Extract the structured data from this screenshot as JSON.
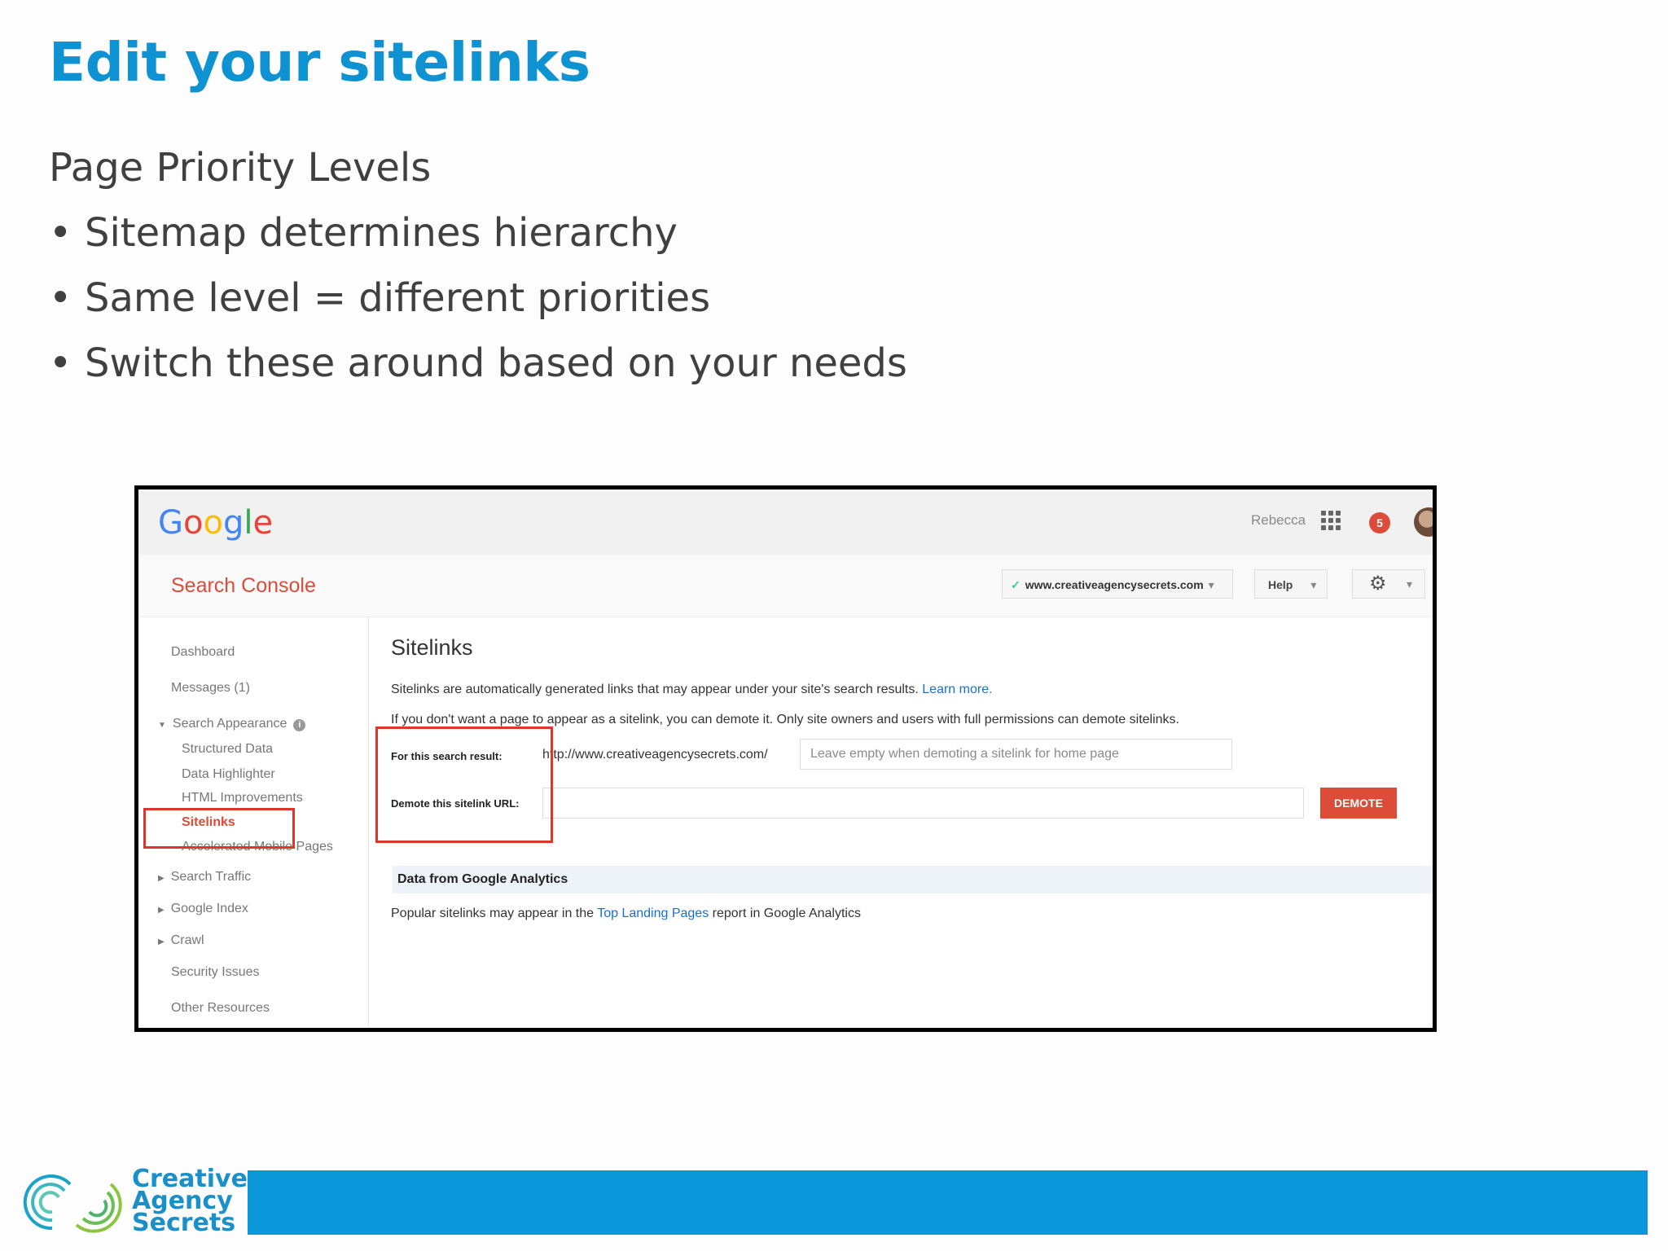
{
  "slide": {
    "title": "Edit your sitelinks",
    "subtitle": "Page Priority Levels",
    "bullets": [
      "Sitemap determines hierarchy",
      "Same level = different priorities",
      "Switch these around based on your needs"
    ],
    "bullet_symbol": "•"
  },
  "screenshot": {
    "header": {
      "logo": "Google",
      "user": "Rebecca",
      "notification_count": "5"
    },
    "toolbar": {
      "title": "Search Console",
      "site": "www.creativeagencysecrets.com",
      "help": "Help"
    },
    "sidebar": {
      "dashboard": "Dashboard",
      "messages": "Messages (1)",
      "search_appearance": "Search Appearance",
      "structured_data": "Structured Data",
      "data_highlighter": "Data Highlighter",
      "html_improvements": "HTML Improvements",
      "sitelinks": "Sitelinks",
      "amp": "Accelerated Mobile Pages",
      "search_traffic": "Search Traffic",
      "google_index": "Google Index",
      "crawl": "Crawl",
      "security_issues": "Security Issues",
      "other_resources": "Other Resources"
    },
    "main": {
      "title": "Sitelinks",
      "desc1": "Sitelinks are automatically generated links that may appear under your site's search results.",
      "learn_more": "Learn more.",
      "desc2": "If you don't want a page to appear as a sitelink, you can demote it. Only site owners and users with full permissions can demote sitelinks.",
      "search_result_label": "For this search result:",
      "url_prefix": "http://www.creativeagencysecrets.com/",
      "search_result_placeholder": "Leave empty when demoting a sitelink for home page",
      "demote_label": "Demote this sitelink URL:",
      "demote_button": "DEMOTE",
      "ga_heading": "Data from Google Analytics",
      "ga_text_before": "Popular sitelinks may appear in the",
      "ga_link": "Top Landing Pages",
      "ga_text_after": "report in Google Analytics"
    }
  },
  "footer": {
    "brand_line1": "Creative",
    "brand_line2": "Agency",
    "brand_line3": "Secrets"
  },
  "colors": {
    "title_blue": "#0f92d2",
    "footer_blue": "#0a97d9",
    "console_red": "#dd4b39",
    "highlight_red": "#e0352b"
  }
}
